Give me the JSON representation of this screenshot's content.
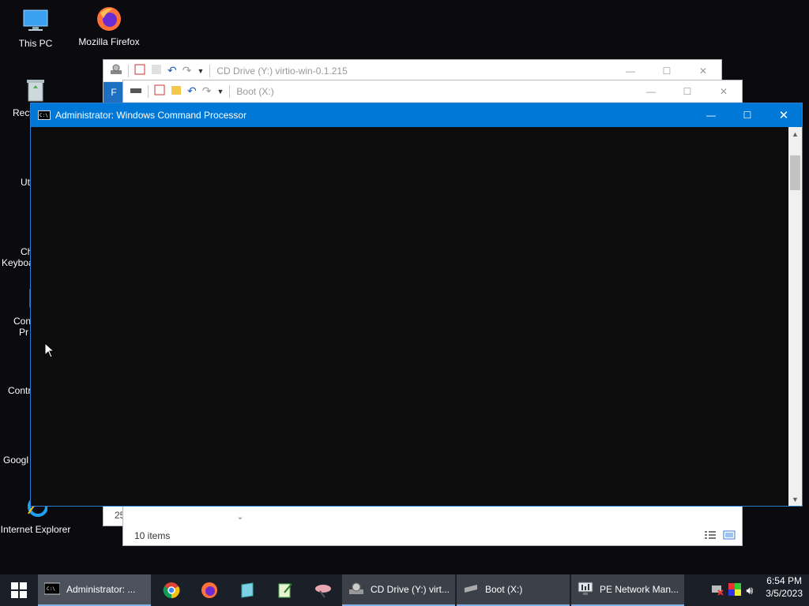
{
  "desktop": {
    "icons": [
      {
        "label": "This PC",
        "icon": "this-pc-icon"
      },
      {
        "label": "Mozilla Firefox",
        "icon": "firefox-icon"
      },
      {
        "label": "Recy",
        "icon": "recycle-bin-icon"
      },
      {
        "label": "Uti",
        "icon": "utilities-icon"
      },
      {
        "label": "Ch",
        "label2": "Keyboa",
        "icon": "keyboard-icon"
      },
      {
        "label": "Con",
        "label2": "Pr",
        "icon": "command-prompt-icon"
      },
      {
        "label": "Contr",
        "icon": "control-panel-icon"
      },
      {
        "label": "Googl",
        "icon": "chrome-icon"
      },
      {
        "label": "Internet Explorer",
        "icon": "internet-explorer-icon"
      }
    ]
  },
  "windows": {
    "cd_drive": {
      "title": "CD Drive (Y:) virtio-win-0.1.215",
      "ribbon_tab": "F",
      "size_fragment": "25"
    },
    "boot": {
      "title": "Boot (X:)",
      "status": "10 items"
    },
    "cmd": {
      "title": "Administrator: Windows Command Processor",
      "icon_text": "C:\\"
    }
  },
  "taskbar": {
    "apps": [
      {
        "label": "Administrator: ...",
        "icon": "cmd-icon",
        "active": true
      },
      {
        "label": "CD Drive (Y:) virt...",
        "icon": "cd-drive-icon"
      },
      {
        "label": "Boot (X:)",
        "icon": "drive-icon"
      },
      {
        "label": "PE Network Man...",
        "icon": "network-manager-icon"
      }
    ],
    "pinned": [
      "chrome-icon",
      "firefox-icon",
      "notepad-icon",
      "edit-icon",
      "satellite-icon"
    ],
    "clock": {
      "time": "6:54 PM",
      "date": "3/5/2023"
    }
  },
  "colors": {
    "accent": "#0078d7",
    "console": "#0c0c0c",
    "taskbar": "#1b1f27"
  }
}
